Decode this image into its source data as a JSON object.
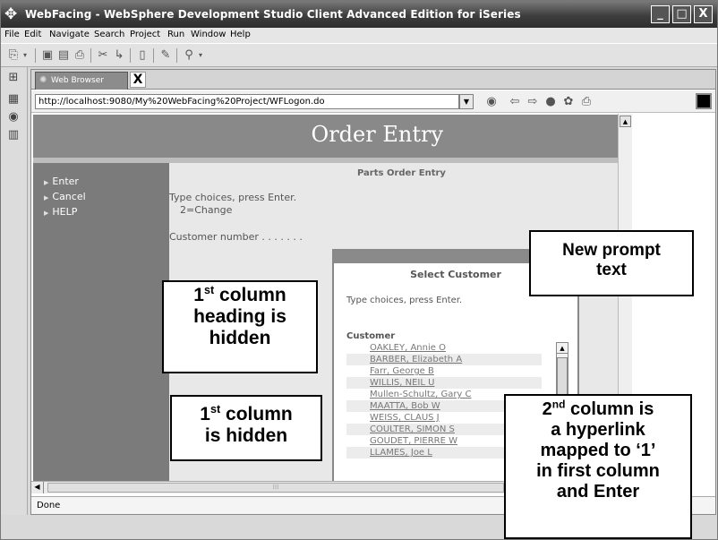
{
  "window": {
    "title": "WebFacing - WebSphere Development Studio Client Advanced Edition for iSeries",
    "controls": [
      "_",
      "□",
      "X"
    ]
  },
  "menu": [
    {
      "label": "File"
    },
    {
      "label": "Edit"
    },
    {
      "label": "Navigate"
    },
    {
      "label": "Search"
    },
    {
      "label": "Project"
    },
    {
      "label": "Run"
    },
    {
      "label": "Window"
    },
    {
      "label": "Help"
    }
  ],
  "editor": {
    "tab_label": "Web Browser",
    "tab_close": "X",
    "address": "http://localhost:9080/My%20WebFacing%20Project/WFLogon.do",
    "status": "Done"
  },
  "page": {
    "header_title": "Order Entry",
    "nav": [
      "Enter",
      "Cancel",
      "HELP"
    ],
    "form_title": "Parts Order Entry",
    "instructions": "Type choices, press Enter.",
    "option": "2=Change",
    "customer_number_label": "Customer number . . . . . . ."
  },
  "dialog": {
    "title": "Select Customer",
    "prompt": "Type choices, press Enter.",
    "column_header": "Customer",
    "customers": [
      "OAKLEY, Annie O",
      "BARBER, Elizabeth A",
      "Farr, George B",
      "WILLIS, NEIL U",
      "Mullen-Schultz, Gary C",
      "MAATTA, Bob W",
      "WEISS, CLAUS J",
      "COULTER, SIMON S",
      "GOUDET, PIERRE W",
      "LLAMES, Joe L"
    ]
  },
  "callouts": {
    "new_prompt": {
      "line1": "New prompt",
      "line2": "text"
    },
    "heading_hidden": {
      "line1a": "1",
      "line1sup": "st",
      "line1b": " column",
      "line2": "heading is",
      "line3": "hidden"
    },
    "column_hidden": {
      "line1a": "1",
      "line1sup": "st",
      "line1b": " column",
      "line2": "is hidden"
    },
    "hyperlink": {
      "line1a": "2",
      "line1sup": "nd",
      "line1b": " column is",
      "line2": "a hyperlink",
      "line3": "mapped to ‘1’",
      "line4": "in first column",
      "line5": "and Enter"
    }
  }
}
